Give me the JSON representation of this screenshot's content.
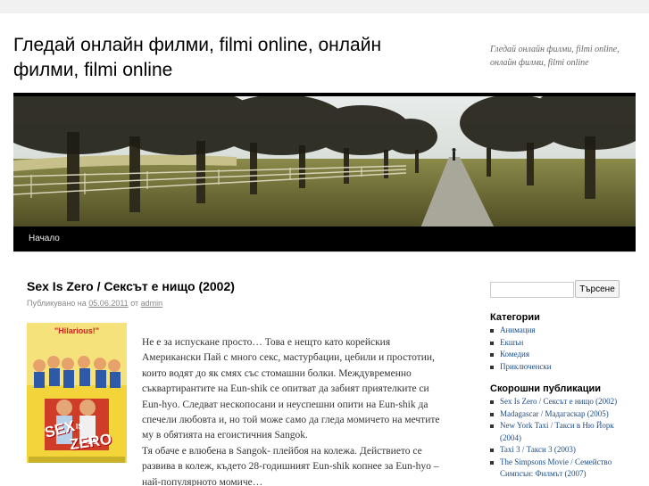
{
  "site": {
    "title": "Гледай онлайн филми, filmi online, онлайн филми, filmi online",
    "description": "Гледай онлайн филми, filmi online, онлайн филми, filmi online"
  },
  "nav": {
    "home": "Начало"
  },
  "post": {
    "title": "Sex Is Zero / Сексът е нищо (2002)",
    "meta_prefix": "Публикувано на",
    "meta_date": "05.06.2011",
    "meta_by": "от",
    "meta_author": "admin",
    "poster": {
      "quote": "\"Hilarious!\"",
      "title_1": "SEX",
      "title_2": "IS",
      "title_3": "ZERO"
    },
    "paragraph_1": "Не е за испускане просто… Това е нещто като корейския Американски Пай с много секс, мастурбации, цебили и простотии, които водят до як смях със стомашни болки. Междувременно съквартирантите на Eun-shik се опитват да забият приятелките си Eun-hyo. Следват нескопосани и неуспешни опити на Eun-shik да спечели любовта и, но той може само да гледа момичето на мечтите му в обятията на егоистичния Sangok.",
    "paragraph_2": "Тя обаче е влюбена в Sangok- плейбоя на колежа.  Действието се развива в колеж, където 28-годишният Eun-shik копнее за Eun-hyo – най-популярното момиче…"
  },
  "sidebar": {
    "search_button": "Търсене",
    "search_value": "",
    "categories_title": "Категории",
    "categories": [
      "Анимация",
      "Екшън",
      "Комедия",
      "Приключенски"
    ],
    "recent_title": "Скорошни публикации",
    "recent": [
      "Sex Is Zero / Сексът е нищо (2002)",
      "Madagascar / Мадагаскар (2005)",
      "New York Taxi / Такси в Ню Йорк (2004)",
      "Taxi 3 / Такси 3 (2003)",
      "The Simpsons Movie / Семейство Симпсън: Филмът (2007)"
    ]
  },
  "colors": {
    "link": "#1b4c8a",
    "nav_bg": "#000000",
    "page_bg": "#f1f1f1"
  }
}
